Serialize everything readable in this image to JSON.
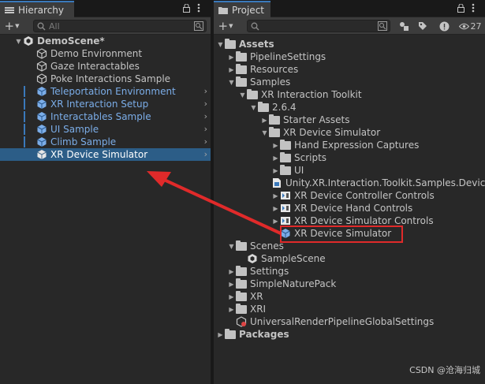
{
  "hierarchy": {
    "tab_label": "Hierarchy",
    "search_placeholder": "All",
    "scene": "DemoScene*",
    "items": [
      {
        "label": "Demo Environment",
        "blue": false
      },
      {
        "label": "Gaze Interactables",
        "blue": false
      },
      {
        "label": "Poke Interactions Sample",
        "blue": false
      },
      {
        "label": "Teleportation Environment",
        "blue": true
      },
      {
        "label": "XR Interaction Setup",
        "blue": true
      },
      {
        "label": "Interactables Sample",
        "blue": true
      },
      {
        "label": "UI Sample",
        "blue": true
      },
      {
        "label": "Climb Sample",
        "blue": true
      },
      {
        "label": "XR Device Simulator",
        "blue": false,
        "selected": true
      }
    ]
  },
  "project": {
    "tab_label": "Project",
    "hidden_count": "27",
    "tree": [
      {
        "label": "Assets",
        "bold": true
      },
      {
        "label": "PipelineSettings"
      },
      {
        "label": "Resources"
      },
      {
        "label": "Samples"
      },
      {
        "label": "XR Interaction Toolkit"
      },
      {
        "label": "2.6.4"
      },
      {
        "label": "Starter Assets"
      },
      {
        "label": "XR Device Simulator"
      },
      {
        "label": "Hand Expression Captures"
      },
      {
        "label": "Scripts"
      },
      {
        "label": "UI"
      },
      {
        "label": "Unity.XR.Interaction.Toolkit.Samples.DeviceSimulator"
      },
      {
        "label": "XR Device Controller Controls"
      },
      {
        "label": "XR Device Hand Controls"
      },
      {
        "label": "XR Device Simulator Controls"
      },
      {
        "label": "XR Device Simulator"
      },
      {
        "label": "Scenes"
      },
      {
        "label": "SampleScene"
      },
      {
        "label": "Settings"
      },
      {
        "label": "SimpleNaturePack"
      },
      {
        "label": "XR"
      },
      {
        "label": "XRI"
      },
      {
        "label": "UniversalRenderPipelineGlobalSettings"
      },
      {
        "label": "Packages",
        "bold": true
      }
    ]
  },
  "watermark": "CSDN @沧海归城",
  "colors": {
    "selection": "#2c5d87",
    "prefab_blue": "#7bade8",
    "annotation_red": "#e02a2a"
  }
}
